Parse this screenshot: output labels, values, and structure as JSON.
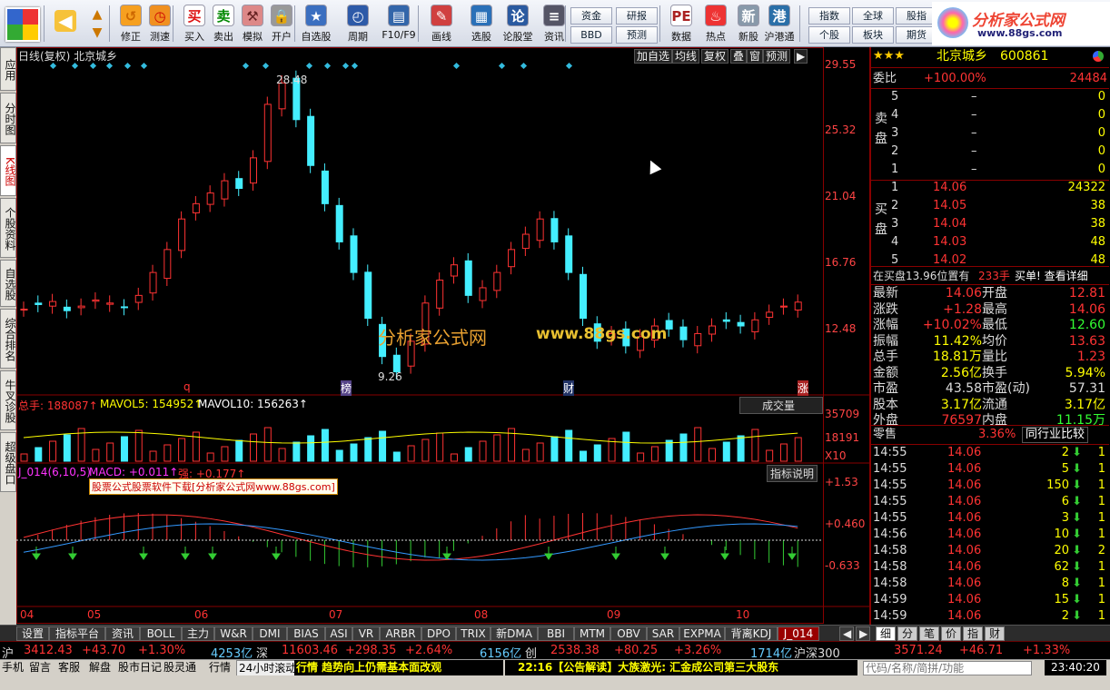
{
  "toolbar": {
    "buttons": [
      {
        "id": "back",
        "label": "",
        "icon": "back-arrow-icon"
      },
      {
        "id": "modify",
        "label": "修正",
        "icon": "modify-icon"
      },
      {
        "id": "test",
        "label": "测速",
        "icon": "clock-icon"
      },
      {
        "id": "buy",
        "label": "买入",
        "icon": "buy-icon"
      },
      {
        "id": "sell",
        "label": "卖出",
        "icon": "sell-icon"
      },
      {
        "id": "sim",
        "label": "模拟",
        "icon": "hammer-icon"
      },
      {
        "id": "open",
        "label": "开户",
        "icon": "lock-icon"
      },
      {
        "id": "watch",
        "label": "自选股",
        "icon": "star-icon"
      },
      {
        "id": "period",
        "label": "周期",
        "icon": "period-icon"
      },
      {
        "id": "f10",
        "label": "F10/F9",
        "icon": "f10-icon"
      },
      {
        "id": "draw",
        "label": "画线",
        "icon": "pencil-icon"
      },
      {
        "id": "pick",
        "label": "选股",
        "icon": "pick-icon"
      },
      {
        "id": "forum",
        "label": "论股堂",
        "icon": "forum-icon"
      },
      {
        "id": "info",
        "label": "资讯",
        "icon": "document-icon"
      },
      {
        "id": "data",
        "label": "数据",
        "icon": "pe-icon"
      },
      {
        "id": "hot",
        "label": "热点",
        "icon": "fire-icon"
      },
      {
        "id": "ipo",
        "label": "新股",
        "icon": "ipo-icon"
      },
      {
        "id": "hk",
        "label": "沪港通",
        "icon": "hk-icon"
      }
    ],
    "text_buttons": [
      "资金",
      "BBD",
      "研报",
      "预测",
      "指数",
      "个股",
      "全球",
      "板块",
      "股指",
      "期货"
    ],
    "logo_text": "分析家公式网",
    "logo_url": "www.88gs.com"
  },
  "side_tabs": [
    "应用",
    "分时图",
    "K线图",
    "个股资料",
    "自选股",
    "综合排名",
    "牛叉诊股",
    "超级盘口"
  ],
  "chart": {
    "header": "日线(复权)  北京城乡",
    "buttons": [
      "加自选",
      "均线",
      "复权",
      "叠",
      "窗",
      "预测",
      "▶"
    ],
    "price_axis": [
      "29.55",
      "25.32",
      "21.04",
      "16.76",
      "12.48"
    ],
    "vol_axis": [
      "35709",
      "18191",
      "X10"
    ],
    "macd_axis": [
      "+1.53",
      "+0.460",
      "-0.633"
    ],
    "x_labels": [
      "04",
      "05",
      "06",
      "07",
      "08",
      "09",
      "10"
    ],
    "high_label": "28.48",
    "low_label": "9.26",
    "markers": {
      "q": "q",
      "bang": "榜",
      "cai": "财",
      "zhang": "涨"
    },
    "watermark1": "分析家公式网",
    "watermark2": "www.88gs.com",
    "vol_header": {
      "total": "总手: 188087↑",
      "ma5": "MAVOL5: 154952↑",
      "ma10": "MAVOL10: 156263↑",
      "select": "成交量"
    },
    "macd_header": {
      "name": "J_014(6,10,5)",
      "macd": "MACD: +0.011↑",
      "s": "强: +0.177↑",
      "help": "指标说明"
    },
    "macd_banner": "股票公式股票软件下载[分析家公式网www.88gs.com]"
  },
  "chart_data": {
    "type": "candlestick",
    "title": "日线(复权) 北京城乡",
    "price_range": [
      9.26,
      29.55
    ],
    "price_ticks": [
      29.55,
      25.32,
      21.04,
      16.76,
      12.48
    ],
    "volume_ticks": [
      35709,
      18191
    ],
    "macd_ticks": [
      1.53,
      0.46,
      -0.633
    ],
    "months": [
      "04",
      "05",
      "06",
      "07",
      "08",
      "09",
      "10"
    ],
    "max_price": 28.48,
    "min_price": 9.26,
    "close_trend": [
      13.6,
      13.9,
      14.1,
      13.5,
      13.8,
      14.2,
      14.0,
      13.7,
      14.5,
      16.0,
      17.5,
      19.5,
      20.5,
      21.2,
      22.0,
      21.5,
      23.5,
      27.0,
      28.4,
      26.0,
      23.0,
      20.5,
      18.0,
      16.0,
      13.0,
      10.5,
      9.5,
      11.5,
      14.0,
      15.5,
      16.5,
      14.5,
      15.0,
      16.0,
      17.5,
      18.5,
      19.5,
      18.0,
      16.0,
      13.0,
      11.5,
      12.0,
      11.2,
      11.8,
      12.5,
      12.3,
      11.6,
      12.0,
      12.5,
      12.8,
      12.5,
      12.9,
      13.4,
      13.8,
      14.06
    ]
  },
  "quote": {
    "name": "北京城乡",
    "code": "600861",
    "stars": "★★★",
    "weibi_label": "委比",
    "weibi": "+100.00%",
    "weicha": "24484",
    "sell_label": "卖盘",
    "buy_label": "买盘",
    "asks": [
      {
        "n": "5",
        "p": "–",
        "v": "0"
      },
      {
        "n": "4",
        "p": "–",
        "v": "0"
      },
      {
        "n": "3",
        "p": "–",
        "v": "0"
      },
      {
        "n": "2",
        "p": "–",
        "v": "0"
      },
      {
        "n": "1",
        "p": "–",
        "v": "0"
      }
    ],
    "bids": [
      {
        "n": "1",
        "p": "14.06",
        "v": "24322"
      },
      {
        "n": "2",
        "p": "14.05",
        "v": "38"
      },
      {
        "n": "3",
        "p": "14.04",
        "v": "38"
      },
      {
        "n": "4",
        "p": "14.03",
        "v": "48"
      },
      {
        "n": "5",
        "p": "14.02",
        "v": "48"
      }
    ],
    "info_line": "在买盘13.96位置有",
    "info_qty": "233手",
    "info_link": "买单! 查看详细",
    "stats": [
      {
        "l1": "最新",
        "v1": "14.06",
        "l2": "开盘",
        "v2": "12.81",
        "c1": "#f33",
        "c2": "#f33"
      },
      {
        "l1": "涨跌",
        "v1": "+1.28",
        "l2": "最高",
        "v2": "14.06",
        "c1": "#f33",
        "c2": "#f33"
      },
      {
        "l1": "涨幅",
        "v1": "+10.02%",
        "l2": "最低",
        "v2": "12.60",
        "c1": "#f33",
        "c2": "#3f3"
      },
      {
        "l1": "振幅",
        "v1": "11.42%",
        "l2": "均价",
        "v2": "13.63",
        "c1": "#ff0",
        "c2": "#f33"
      },
      {
        "l1": "总手",
        "v1": "18.81万",
        "l2": "量比",
        "v2": "1.23",
        "c1": "#ff0",
        "c2": "#f33"
      },
      {
        "l1": "金额",
        "v1": "2.56亿",
        "l2": "换手",
        "v2": "5.94%",
        "c1": "#ff0",
        "c2": "#ff0"
      },
      {
        "l1": "市盈",
        "v1": "43.58",
        "l2": "市盈(动)",
        "v2": "57.31",
        "c1": "#ddd",
        "c2": "#ddd"
      },
      {
        "l1": "股本",
        "v1": "3.17亿",
        "l2": "流通",
        "v2": "3.17亿",
        "c1": "#ff0",
        "c2": "#ff0"
      },
      {
        "l1": "外盘",
        "v1": "76597",
        "l2": "内盘",
        "v2": "11.15万",
        "c1": "#f33",
        "c2": "#3f3"
      }
    ],
    "lingshou": "零售",
    "lingshou_pct": "3.36%",
    "compare": "同行业比较",
    "ticks": [
      {
        "t": "14:55",
        "p": "14.06",
        "v": "2",
        "n": "1"
      },
      {
        "t": "14:55",
        "p": "14.06",
        "v": "5",
        "n": "1"
      },
      {
        "t": "14:55",
        "p": "14.06",
        "v": "150",
        "n": "1"
      },
      {
        "t": "14:55",
        "p": "14.06",
        "v": "6",
        "n": "1"
      },
      {
        "t": "14:55",
        "p": "14.06",
        "v": "3",
        "n": "1"
      },
      {
        "t": "14:56",
        "p": "14.06",
        "v": "10",
        "n": "1"
      },
      {
        "t": "14:58",
        "p": "14.06",
        "v": "20",
        "n": "2"
      },
      {
        "t": "14:58",
        "p": "14.06",
        "v": "62",
        "n": "1"
      },
      {
        "t": "14:58",
        "p": "14.06",
        "v": "8",
        "n": "1"
      },
      {
        "t": "14:59",
        "p": "14.06",
        "v": "15",
        "n": "1"
      },
      {
        "t": "14:59",
        "p": "14.06",
        "v": "2",
        "n": "1"
      }
    ],
    "tabs": [
      "细",
      "分",
      "笔",
      "价",
      "指",
      "财"
    ]
  },
  "indicator_tabs": [
    "设置",
    "指标平台",
    "资讯",
    "BOLL",
    "主力",
    "W&R",
    "DMI",
    "BIAS",
    "ASI",
    "VR",
    "ARBR",
    "DPO",
    "TRIX",
    "新DMA",
    "BBI",
    "MTM",
    "OBV",
    "SAR",
    "EXPMA",
    "背离KDJ",
    "J_014"
  ],
  "ticker": [
    {
      "text": "沪",
      "c": "#ddd"
    },
    {
      "text": "3412.43",
      "c": "#f33"
    },
    {
      "text": "+43.70",
      "c": "#f33"
    },
    {
      "text": "+1.30%",
      "c": "#f33"
    },
    {
      "text": "4253亿",
      "c": "#6cf"
    },
    {
      "text": "深",
      "c": "#ddd"
    },
    {
      "text": "11603.46",
      "c": "#f33"
    },
    {
      "text": "+298.35",
      "c": "#f33"
    },
    {
      "text": "+2.64%",
      "c": "#f33"
    },
    {
      "text": "6156亿",
      "c": "#6cf"
    },
    {
      "text": "创",
      "c": "#ddd"
    },
    {
      "text": "2538.38",
      "c": "#f33"
    },
    {
      "text": "+80.25",
      "c": "#f33"
    },
    {
      "text": "+3.26%",
      "c": "#f33"
    },
    {
      "text": "1714亿",
      "c": "#6cf"
    },
    {
      "text": "沪深300",
      "c": "#ddd"
    },
    {
      "text": "3571.24",
      "c": "#f33"
    },
    {
      "text": "+46.71",
      "c": "#f33"
    },
    {
      "text": "+1.33%",
      "c": "#f33"
    }
  ],
  "status": {
    "items": [
      "手机",
      "留言",
      "客服",
      "解盘",
      "股市日记",
      "股灵通",
      "行情",
      "24小时滚动"
    ],
    "news1": "行情 趋势向上仍需基本面改观",
    "news2": "22:16【公告解读】大族激光: 汇金成公司第三大股东",
    "search_placeholder": "代码/名称/简拼/功能",
    "clock": "23:40:20"
  }
}
